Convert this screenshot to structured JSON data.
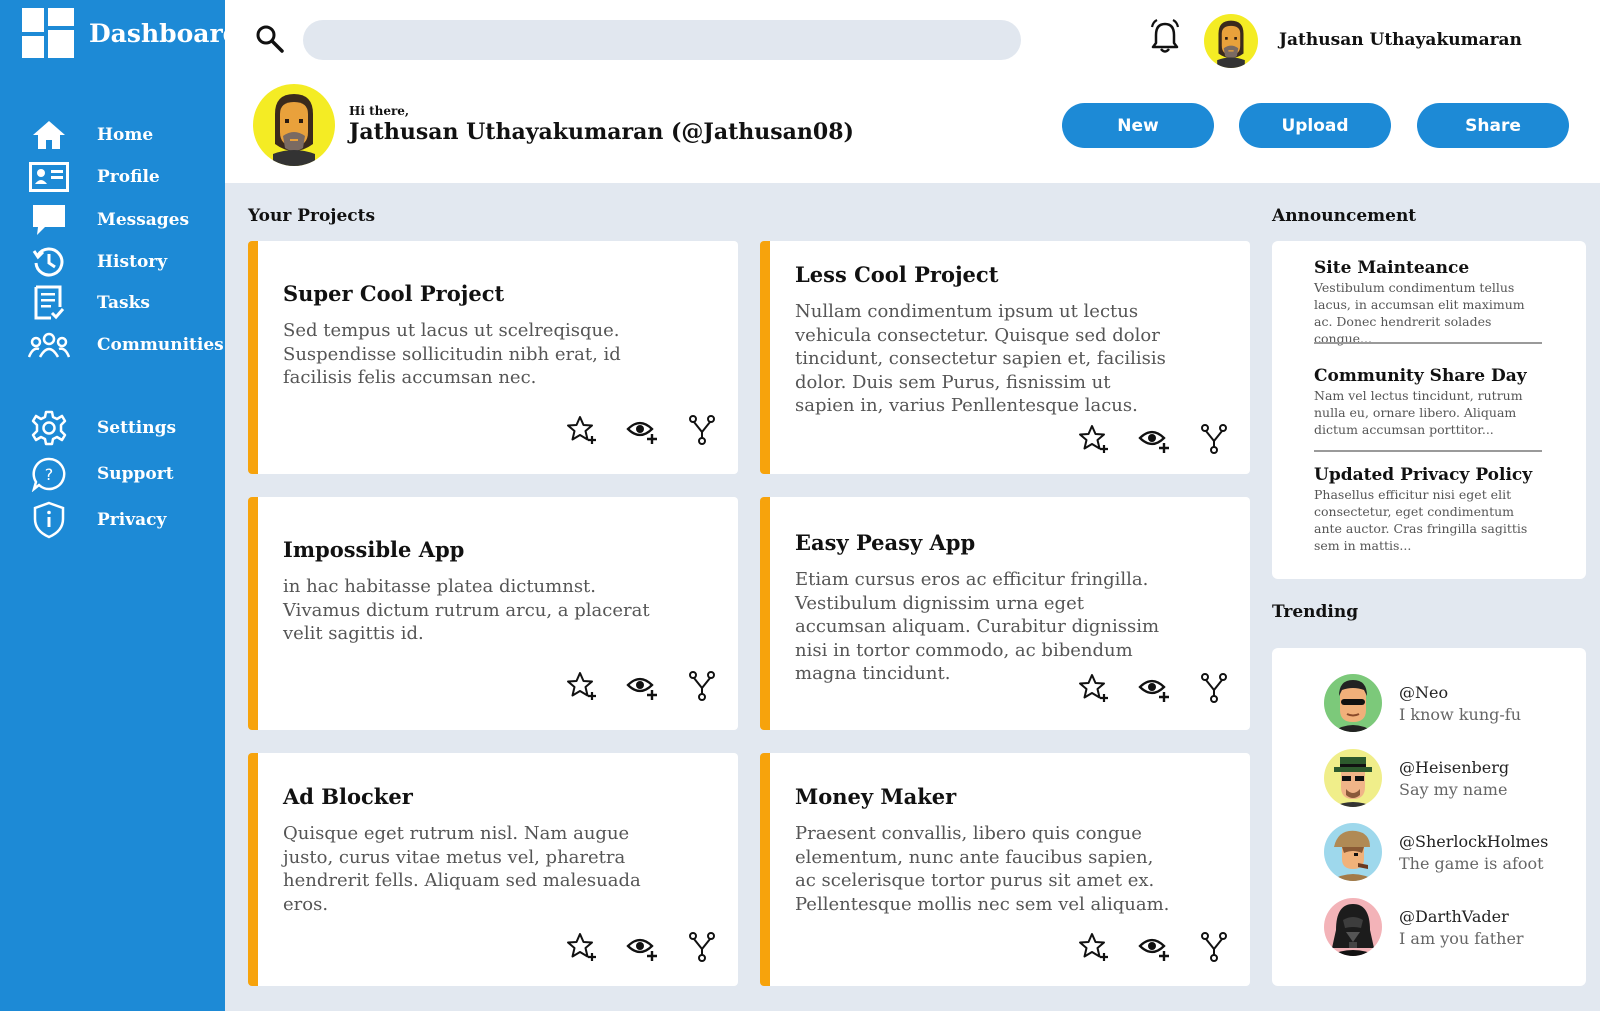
{
  "brand": {
    "title": "Dashboard"
  },
  "sidebar": {
    "items": [
      {
        "label": "Home",
        "icon": "home-icon"
      },
      {
        "label": "Profile",
        "icon": "profile-card-icon"
      },
      {
        "label": "Messages",
        "icon": "message-icon"
      },
      {
        "label": "History",
        "icon": "history-icon"
      },
      {
        "label": "Tasks",
        "icon": "tasks-icon"
      },
      {
        "label": "Communities",
        "icon": "communities-icon"
      },
      {
        "label": "Settings",
        "icon": "gear-icon"
      },
      {
        "label": "Support",
        "icon": "question-icon"
      },
      {
        "label": "Privacy",
        "icon": "shield-icon"
      }
    ]
  },
  "header": {
    "search_placeholder": "",
    "user_name": "Jathusan Uthayakumaran",
    "greeting_small": "Hi there,",
    "greeting_name": "Jathusan Uthayakumaran (@Jathusan08)",
    "buttons": {
      "new": "New",
      "upload": "Upload",
      "share": "Share"
    }
  },
  "projects": {
    "title": "Your Projects",
    "items": [
      {
        "title": "Super Cool Project",
        "desc": "Sed tempus ut lacus ut scelreqisque. Suspendisse sollicitudin nibh erat, id facilisis felis accumsan nec."
      },
      {
        "title": "Less Cool Project",
        "desc": "Nullam condimentum ipsum ut lectus vehicula consectetur. Quisque sed dolor tincidunt, consectetur sapien et, facilisis dolor. Duis sem Purus, fisnissim ut sapien in, varius Penllentesque lacus."
      },
      {
        "title": "Impossible App",
        "desc": "in hac habitasse platea dictumnst. Vivamus dictum rutrum arcu, a placerat velit sagittis id."
      },
      {
        "title": "Easy Peasy App",
        "desc": "Etiam cursus eros ac efficitur fringilla. Vestibulum dignissim urna eget accumsan aliquam. Curabitur dignissim nisi in tortor commodo, ac bibendum magna tincidunt."
      },
      {
        "title": "Ad Blocker",
        "desc": "Quisque eget rutrum nisl. Nam augue justo, curus vitae metus vel, pharetra hendrerit fells. Aliquam sed malesuada eros."
      },
      {
        "title": "Money Maker",
        "desc": "Praesent convallis, libero quis congue elementum, nunc ante faucibus sapien, ac scelerisque tortor purus sit amet ex. Pellentesque mollis nec sem vel aliquam."
      }
    ]
  },
  "announcements": {
    "title": "Announcement",
    "items": [
      {
        "title": "Site Mainteance",
        "body": "Vestibulum condimentum tellus lacus, in accumsan elit maximum ac. Donec hendrerit solades congue..."
      },
      {
        "title": "Community Share Day",
        "body": "Nam vel lectus tincidunt, rutrum nulla eu, ornare libero. Aliquam dictum accumsan porttitor..."
      },
      {
        "title": "Updated Privacy Policy",
        "body": "Phasellus efficitur nisi eget elit consectetur, eget condimentum ante auctor. Cras fringilla sagittis sem in mattis..."
      }
    ]
  },
  "trending": {
    "title": "Trending",
    "items": [
      {
        "handle": "@Neo",
        "tagline": "I know kung-fu"
      },
      {
        "handle": "@Heisenberg",
        "tagline": "Say my name"
      },
      {
        "handle": "@SherlockHolmes",
        "tagline": "The game is afoot"
      },
      {
        "handle": "@DarthVader",
        "tagline": "I am you father"
      }
    ]
  },
  "colors": {
    "sidebar": "#1d8ad6",
    "accent_border": "#f7a30c",
    "avatar_bg": "#f4ec24",
    "page_bg": "#e2e8f0"
  }
}
